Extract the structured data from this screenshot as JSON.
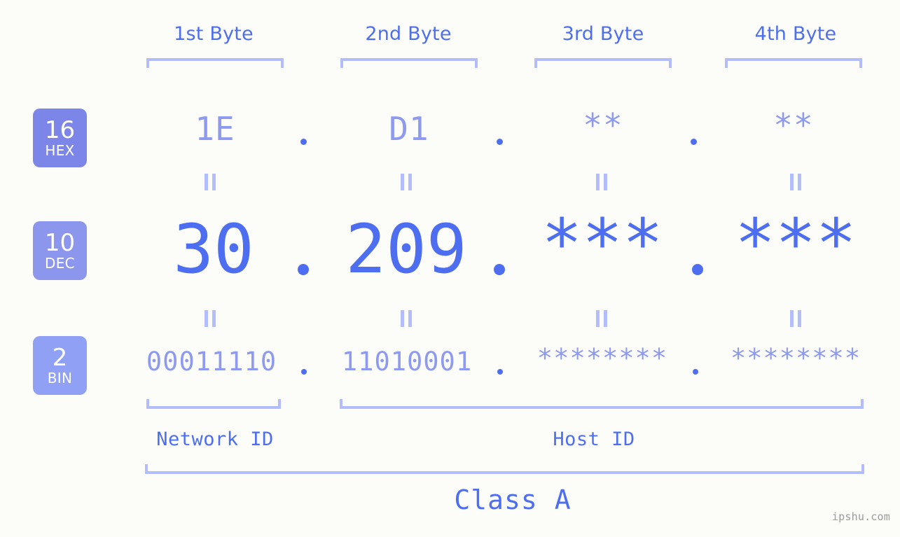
{
  "colors": {
    "background": "#fcfdf8",
    "accent_strong": "#4e6ef2",
    "accent_light": "#8d9af0",
    "bracket": "#b4bdfb",
    "badge_hex": "#7b86e8",
    "badge_dec": "#8b96ec",
    "badge_bin": "#8fa0f5",
    "watermark": "#9a9a9a"
  },
  "byte_headers": [
    {
      "label": "1st Byte"
    },
    {
      "label": "2nd Byte"
    },
    {
      "label": "3rd Byte"
    },
    {
      "label": "4th Byte"
    }
  ],
  "bases": [
    {
      "number": "16",
      "name": "HEX"
    },
    {
      "number": "10",
      "name": "DEC"
    },
    {
      "number": "2",
      "name": "BIN"
    }
  ],
  "rows": {
    "hex": {
      "octets": [
        "1E",
        "D1",
        "**",
        "**"
      ]
    },
    "dec": {
      "octets": [
        "30",
        "209",
        "***",
        "***"
      ]
    },
    "bin": {
      "octets": [
        "00011110",
        "11010001",
        "********",
        "********"
      ]
    }
  },
  "separator": ".",
  "equals_sign": "||",
  "segments": {
    "network_id": "Network ID",
    "host_id": "Host ID"
  },
  "class_label": "Class A",
  "watermark": "ipshu.com"
}
